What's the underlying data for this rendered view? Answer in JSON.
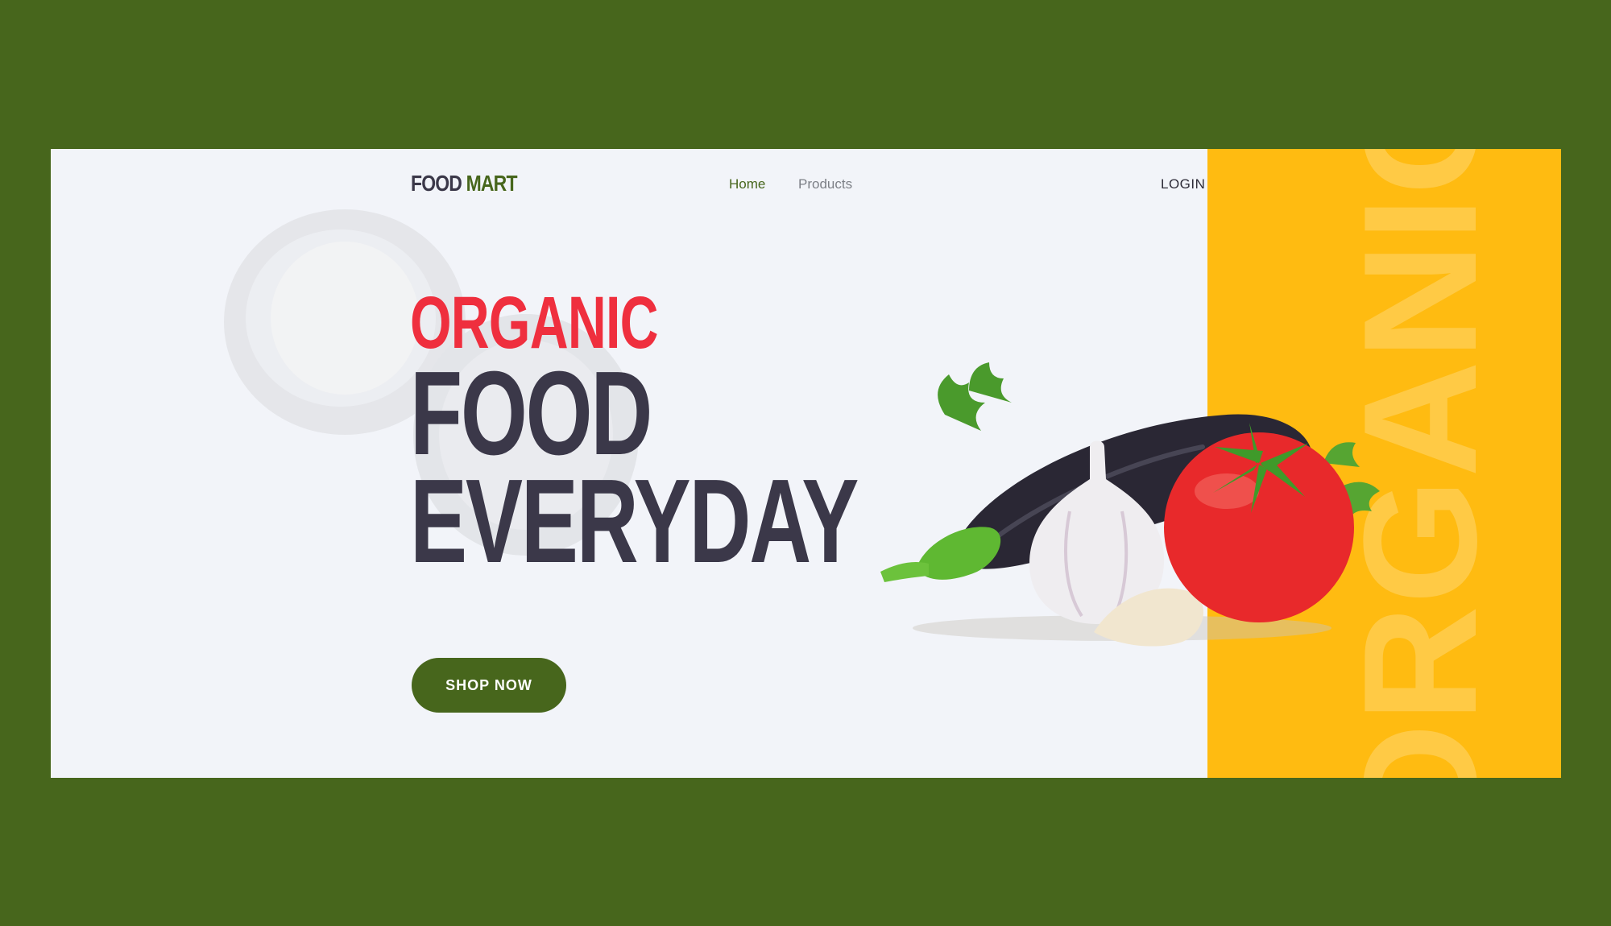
{
  "brand": {
    "word1": "FOOD",
    "word2": "MART"
  },
  "nav": {
    "home": "Home",
    "products": "Products",
    "login": "LOGIN"
  },
  "hero": {
    "line1": "ORGANIC",
    "line2": "FOOD",
    "line3": "EVERYDAY",
    "cta": "SHOP NOW"
  },
  "side_panel": {
    "vertical_word": "ORGANIC"
  },
  "colors": {
    "outer_bg": "#47661c",
    "page_bg": "#f2f4f9",
    "accent_red": "#ef2f3e",
    "heading_dark": "#3b3849",
    "panel_yellow": "#ffbb11",
    "button_green": "#47661c"
  },
  "images": {
    "hero_illustration": "vegetables (eggplant, garlic, tomato, parsley)",
    "background_ghost": "faded cut avocado"
  }
}
